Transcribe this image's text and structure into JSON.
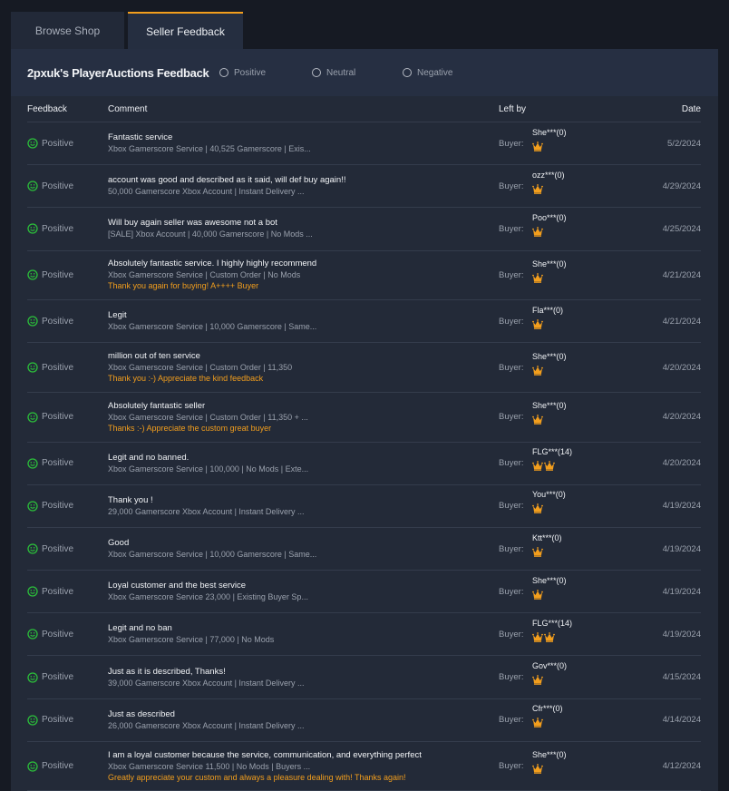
{
  "tabs": [
    {
      "label": "Browse Shop",
      "active": false
    },
    {
      "label": "Seller Feedback",
      "active": true
    }
  ],
  "header": {
    "title": "2pxuk's PlayerAuctions Feedback",
    "filters": [
      {
        "label": "Positive",
        "icon": "radio-unchecked-icon"
      },
      {
        "label": "Neutral",
        "icon": "radio-unchecked-icon"
      },
      {
        "label": "Negative",
        "icon": "radio-unchecked-icon"
      }
    ]
  },
  "colors": {
    "accent": "#f29e1d",
    "positive": "#2bbf3a",
    "reply": "#f29e1d"
  },
  "table": {
    "columns": [
      "Feedback",
      "Comment",
      "Left by",
      "Date"
    ],
    "rows": [
      {
        "rating": "Positive",
        "comment": "Fantastic service",
        "item": "Xbox Gamerscore Service | 40,525 Gamerscore | Exis...",
        "reply": "",
        "buyer_label": "Buyer:",
        "user": "She***(0)",
        "crowns": 1,
        "date": "5/2/2024"
      },
      {
        "rating": "Positive",
        "comment": "account was good and described as it said, will def buy again!!",
        "item": "50,000 Gamerscore Xbox Account | Instant Delivery ...",
        "reply": "",
        "buyer_label": "Buyer:",
        "user": "ozz***(0)",
        "crowns": 1,
        "date": "4/29/2024"
      },
      {
        "rating": "Positive",
        "comment": "Will buy again seller was awesome not a bot",
        "item": "[SALE] Xbox Account | 40,000 Gamerscore | No Mods ...",
        "reply": "",
        "buyer_label": "Buyer:",
        "user": "Poo***(0)",
        "crowns": 1,
        "date": "4/25/2024"
      },
      {
        "rating": "Positive",
        "comment": "Absolutely fantastic service. I highly highly recommend",
        "item": "Xbox Gamerscore Service | Custom Order | No Mods",
        "reply": "Thank you again for buying! A++++ Buyer",
        "buyer_label": "Buyer:",
        "user": "She***(0)",
        "crowns": 1,
        "date": "4/21/2024"
      },
      {
        "rating": "Positive",
        "comment": "Legit",
        "item": "Xbox Gamerscore Service | 10,000 Gamerscore | Same...",
        "reply": "",
        "buyer_label": "Buyer:",
        "user": "Fla***(0)",
        "crowns": 1,
        "date": "4/21/2024"
      },
      {
        "rating": "Positive",
        "comment": "million out of ten service",
        "item": "Xbox Gamerscore Service | Custom Order | 11,350",
        "reply": "Thank you :-) Appreciate the kind feedback",
        "buyer_label": "Buyer:",
        "user": "She***(0)",
        "crowns": 1,
        "date": "4/20/2024"
      },
      {
        "rating": "Positive",
        "comment": "Absolutely fantastic seller",
        "item": "Xbox Gamerscore Service | Custom Order | 11,350 + ...",
        "reply": "Thanks :-) Appreciate the custom great buyer",
        "buyer_label": "Buyer:",
        "user": "She***(0)",
        "crowns": 1,
        "date": "4/20/2024"
      },
      {
        "rating": "Positive",
        "comment": "Legit and no banned.",
        "item": "Xbox Gamerscore Service | 100,000 | No Mods | Exte...",
        "reply": "",
        "buyer_label": "Buyer:",
        "user": "FLG***(14)",
        "crowns": 2,
        "date": "4/20/2024"
      },
      {
        "rating": "Positive",
        "comment": "Thank you !",
        "item": "29,000 Gamerscore Xbox Account | Instant Delivery ...",
        "reply": "",
        "buyer_label": "Buyer:",
        "user": "You***(0)",
        "crowns": 1,
        "date": "4/19/2024"
      },
      {
        "rating": "Positive",
        "comment": "Good",
        "item": "Xbox Gamerscore Service | 10,000 Gamerscore | Same...",
        "reply": "",
        "buyer_label": "Buyer:",
        "user": "Ktt***(0)",
        "crowns": 1,
        "date": "4/19/2024"
      },
      {
        "rating": "Positive",
        "comment": "Loyal customer and the best service",
        "item": "Xbox Gamerscore Service 23,000 | Existing Buyer Sp...",
        "reply": "",
        "buyer_label": "Buyer:",
        "user": "She***(0)",
        "crowns": 1,
        "date": "4/19/2024"
      },
      {
        "rating": "Positive",
        "comment": "Legit and no ban",
        "item": "Xbox Gamerscore Service | 77,000 | No Mods",
        "reply": "",
        "buyer_label": "Buyer:",
        "user": "FLG***(14)",
        "crowns": 2,
        "date": "4/19/2024"
      },
      {
        "rating": "Positive",
        "comment": "Just as it is described, Thanks!",
        "item": "39,000 Gamerscore Xbox Account | Instant Delivery ...",
        "reply": "",
        "buyer_label": "Buyer:",
        "user": "Gov***(0)",
        "crowns": 1,
        "date": "4/15/2024"
      },
      {
        "rating": "Positive",
        "comment": "Just as described",
        "item": "26,000 Gamerscore Xbox Account | Instant Delivery ...",
        "reply": "",
        "buyer_label": "Buyer:",
        "user": "Cfr***(0)",
        "crowns": 1,
        "date": "4/14/2024"
      },
      {
        "rating": "Positive",
        "comment": "I am a loyal customer because the service, communication, and everything perfect",
        "item": "Xbox Gamerscore Service 11,500 | No Mods | Buyers ...",
        "reply": "Greatly appreciate your custom and always a pleasure dealing with! Thanks again!",
        "buyer_label": "Buyer:",
        "user": "She***(0)",
        "crowns": 1,
        "date": "4/12/2024"
      }
    ]
  }
}
